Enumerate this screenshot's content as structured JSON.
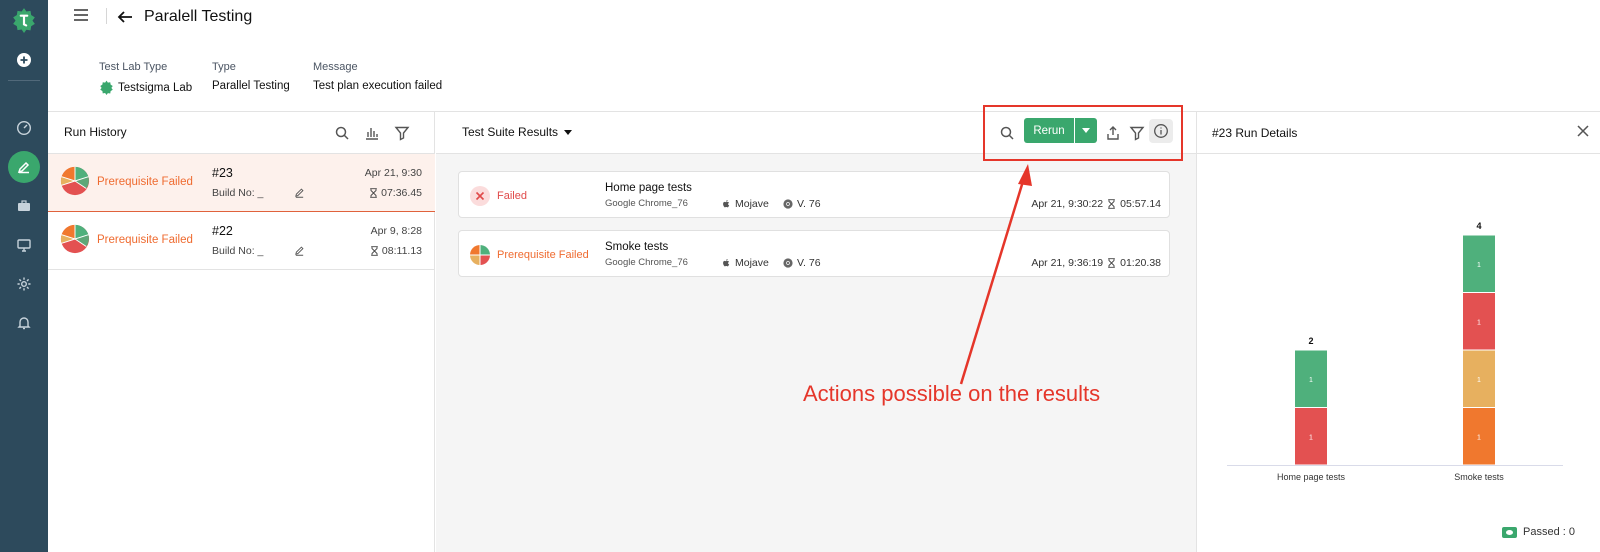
{
  "app": {
    "page_title": "Paralell Testing"
  },
  "meta": [
    {
      "label": "Test Lab Type",
      "value": "Testsigma Lab"
    },
    {
      "label": "Type",
      "value": "Parallel Testing"
    },
    {
      "label": "Message",
      "value": "Test plan execution failed"
    }
  ],
  "run_history": {
    "title": "Run History",
    "runs": [
      {
        "status": "Prerequisite Failed",
        "number": "#23",
        "build": "Build No: _",
        "date": "Apr 21, 9:30",
        "duration": "07:36.45",
        "selected": true
      },
      {
        "status": "Prerequisite Failed",
        "number": "#22",
        "build": "Build No: _",
        "date": "Apr 9, 8:28",
        "duration": "08:11.13",
        "selected": false
      }
    ]
  },
  "suite_results": {
    "title": "Test Suite Results",
    "rerun_label": "Rerun",
    "items": [
      {
        "status": "Failed",
        "name": "Home page tests",
        "browser": "Google Chrome_76",
        "os": "Mojave",
        "version": "V. 76",
        "date": "Apr 21, 9:30:22",
        "duration": "05:57.14"
      },
      {
        "status": "Prerequisite Failed",
        "name": "Smoke tests",
        "browser": "Google Chrome_76",
        "os": "Mojave",
        "version": "V. 76",
        "date": "Apr 21, 9:36:19",
        "duration": "01:20.38"
      }
    ]
  },
  "run_details": {
    "title": "#23 Run Details",
    "legend_label": "Passed : 0"
  },
  "chart_data": {
    "type": "bar",
    "stacked": true,
    "categories": [
      "Home page tests",
      "Smoke tests"
    ],
    "totals": [
      2,
      4
    ],
    "series": [
      {
        "color": "#e35151",
        "values": [
          1,
          0
        ]
      },
      {
        "color": "#f0782e",
        "values": [
          0,
          1
        ]
      },
      {
        "color": "#e7b05f",
        "values": [
          0,
          1
        ]
      },
      {
        "color": "#e35151",
        "values": [
          0,
          1
        ]
      },
      {
        "color": "#4fb07c",
        "values": [
          1,
          1
        ]
      }
    ],
    "legend": [
      "Passed : 0"
    ],
    "legend_position": "bottom-right",
    "grid": false
  },
  "annotation": {
    "text": "Actions possible on the results",
    "color": "#e5362a"
  },
  "colors": {
    "accent": "#3aa76d",
    "sidebar": "#2d4a5c",
    "prerequisite": "#ef6b30",
    "failed": "#e04a4a"
  }
}
